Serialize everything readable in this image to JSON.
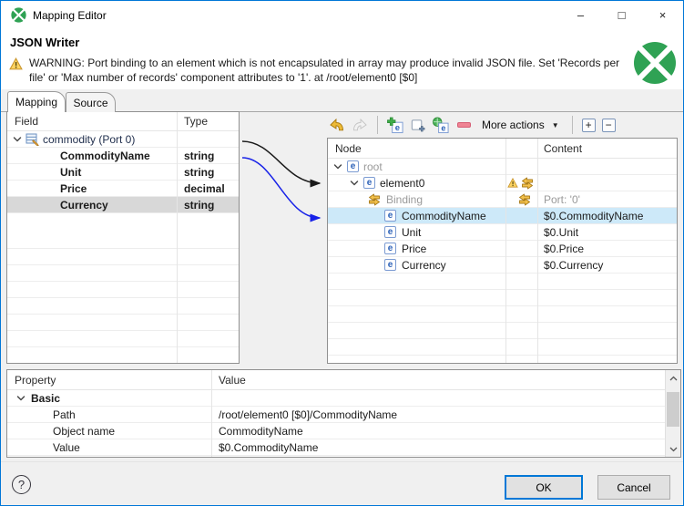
{
  "window": {
    "title": "Mapping Editor",
    "controls": {
      "minimize": "–",
      "maximize": "□",
      "close": "×"
    }
  },
  "header": {
    "component_title": "JSON Writer",
    "warning_text": "WARNING: Port binding to an element which is not encapsulated in array may produce invalid JSON file. Set 'Records per file' or 'Max number of records' component attributes to '1'. at /root/element0 [$0]"
  },
  "tabs": {
    "mapping": {
      "label": "Mapping",
      "active": true
    },
    "source": {
      "label": "Source",
      "active": false
    }
  },
  "field_table": {
    "header_field": "Field",
    "header_type": "Type",
    "root_label": "commodity (Port 0)",
    "rows": [
      {
        "field": "CommodityName",
        "type": "string",
        "selected": false
      },
      {
        "field": "Unit",
        "type": "string",
        "selected": false
      },
      {
        "field": "Price",
        "type": "decimal",
        "selected": false
      },
      {
        "field": "Currency",
        "type": "string",
        "selected": true
      }
    ]
  },
  "toolbar": {
    "more_actions_label": "More actions",
    "icons": {
      "undo": "curved-arrow-left-gold",
      "redo": "curved-arrow-right-gray-disabled",
      "add_element": "element-box-with-green-plus",
      "add_attribute": "rect-with-plus",
      "add_wildcard_element": "green-globe-with-element-box",
      "remove": "red-dash",
      "dropdown_arrow": "▼",
      "expand_all": "+",
      "collapse_all": "−"
    }
  },
  "node_table": {
    "header_node": "Node",
    "header_content": "Content",
    "root": {
      "label": "root"
    },
    "element0": {
      "label": "element0"
    },
    "binding": {
      "label": "Binding",
      "content": "Port: '0'"
    },
    "rows": [
      {
        "node": "CommodityName",
        "content": "$0.CommodityName",
        "selected": true
      },
      {
        "node": "Unit",
        "content": "$0.Unit",
        "selected": false
      },
      {
        "node": "Price",
        "content": "$0.Price",
        "selected": false
      },
      {
        "node": "Currency",
        "content": "$0.Currency",
        "selected": false
      }
    ]
  },
  "property_table": {
    "header_property": "Property",
    "header_value": "Value",
    "group_label": "Basic",
    "rows": [
      {
        "property": "Path",
        "value": "/root/element0 [$0]/CommodityName"
      },
      {
        "property": "Object name",
        "value": "CommodityName"
      },
      {
        "property": "Value",
        "value": "$0.CommodityName"
      }
    ]
  },
  "footer": {
    "help": "?",
    "ok_label": "OK",
    "cancel_label": "Cancel"
  },
  "colors": {
    "accent_border": "#0177d7",
    "logo_green": "#2fa254",
    "selection_blue": "#cde9f9",
    "selection_gray": "#d8d8d8",
    "warning_gold": "#e2a21f"
  }
}
